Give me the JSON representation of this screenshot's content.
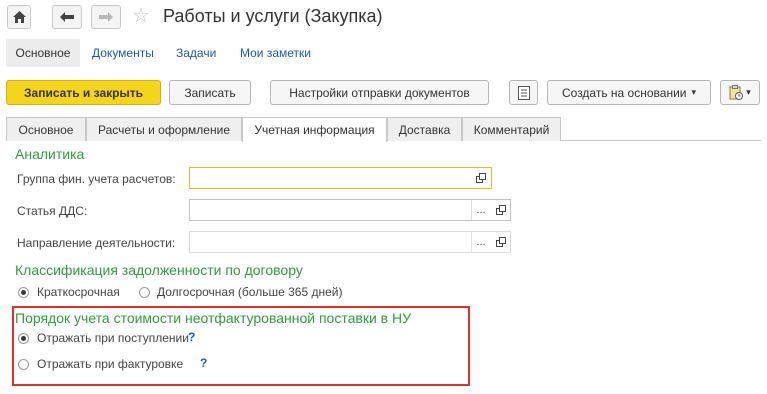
{
  "window": {
    "title": "Работы и услуги (Закупка)"
  },
  "nav": {
    "home_icon": "home-icon",
    "back_icon": "arrow-left-icon",
    "forward_icon": "arrow-right-icon",
    "favorite_icon": "star-icon"
  },
  "sections": [
    {
      "label": "Основное"
    },
    {
      "label": "Документы"
    },
    {
      "label": "Задачи"
    },
    {
      "label": "Мои заметки"
    }
  ],
  "toolbar": {
    "save_close": "Записать и закрыть",
    "save": "Записать",
    "send_settings": "Настройки отправки документов",
    "create_based": "Создать на основании",
    "dropdown_arrow": "▾"
  },
  "tabs": [
    {
      "label": "Основное"
    },
    {
      "label": "Расчеты и оформление"
    },
    {
      "label": "Учетная информация"
    },
    {
      "label": "Доставка"
    },
    {
      "label": "Комментарий"
    }
  ],
  "analytics": {
    "heading": "Аналитика",
    "group_label": "Группа фин. учета расчетов:",
    "group_value": "",
    "dds_label": "Статья ДДС:",
    "dds_value": "",
    "direction_label": "Направление деятельности:",
    "direction_value": "",
    "select_button": "...",
    "open_icon": "open-icon"
  },
  "classification": {
    "heading": "Классификация задолженности по договору",
    "options": [
      {
        "label": "Краткосрочная",
        "selected": true
      },
      {
        "label": "Долгосрочная (больше 365 дней)",
        "selected": false
      }
    ]
  },
  "cost_order": {
    "heading": "Порядок учета стоимости неотфактурованной поставки в НУ",
    "options": [
      {
        "label": "Отражать при поступлении",
        "selected": true
      },
      {
        "label": "Отражать при фактуровке",
        "selected": false
      }
    ],
    "help": "?"
  },
  "colors": {
    "accent_green": "#2e9e3d",
    "primary_yellow": "#f5d51c",
    "highlight_red": "#e03030",
    "link_blue": "#1a5bb5"
  }
}
